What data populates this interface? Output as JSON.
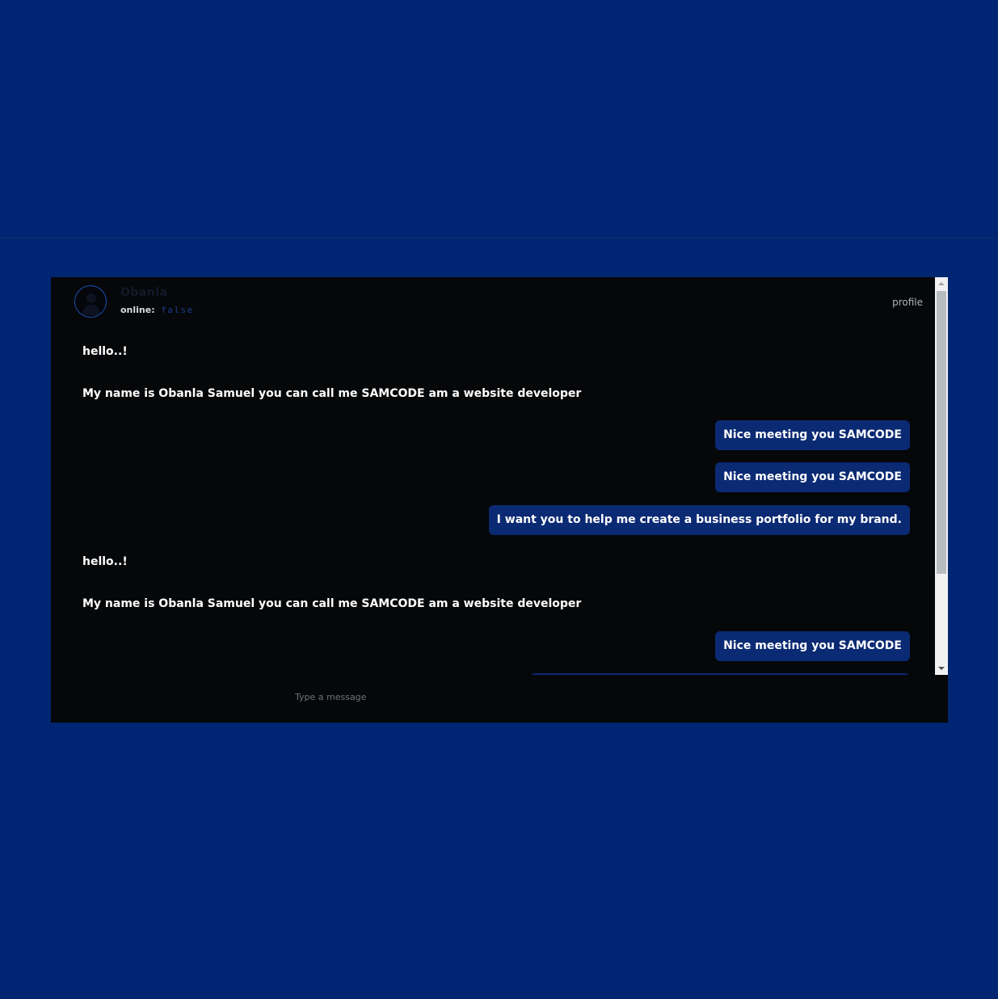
{
  "header": {
    "contact_name": "Obanla",
    "status_label": "online:",
    "status_value": "false",
    "profile_link": "profile"
  },
  "messages": [
    {
      "direction": "received",
      "text": "hello..!"
    },
    {
      "direction": "received",
      "text": "My name is Obanla Samuel you can call me SAMCODE am a website developer"
    },
    {
      "direction": "sent",
      "text": "Nice meeting you SAMCODE"
    },
    {
      "direction": "sent",
      "text": "Nice meeting you SAMCODE"
    },
    {
      "direction": "sent",
      "text": "I want you to help me create a business portfolio for my brand."
    },
    {
      "direction": "received",
      "text": "hello..!"
    },
    {
      "direction": "received",
      "text": "My name is Obanla Samuel you can call me SAMCODE am a website developer"
    },
    {
      "direction": "sent",
      "text": "Nice meeting you SAMCODE"
    }
  ],
  "composer": {
    "placeholder": "Type a message",
    "value": ""
  },
  "colors": {
    "page_background": "#002673",
    "chat_background": "#060709",
    "sent_bubble": "#0b2a74",
    "status_false": "#1a3d8f"
  },
  "icons": {
    "avatar": "user-silhouette",
    "scroll_up": "triangle-up",
    "scroll_down": "triangle-down"
  }
}
